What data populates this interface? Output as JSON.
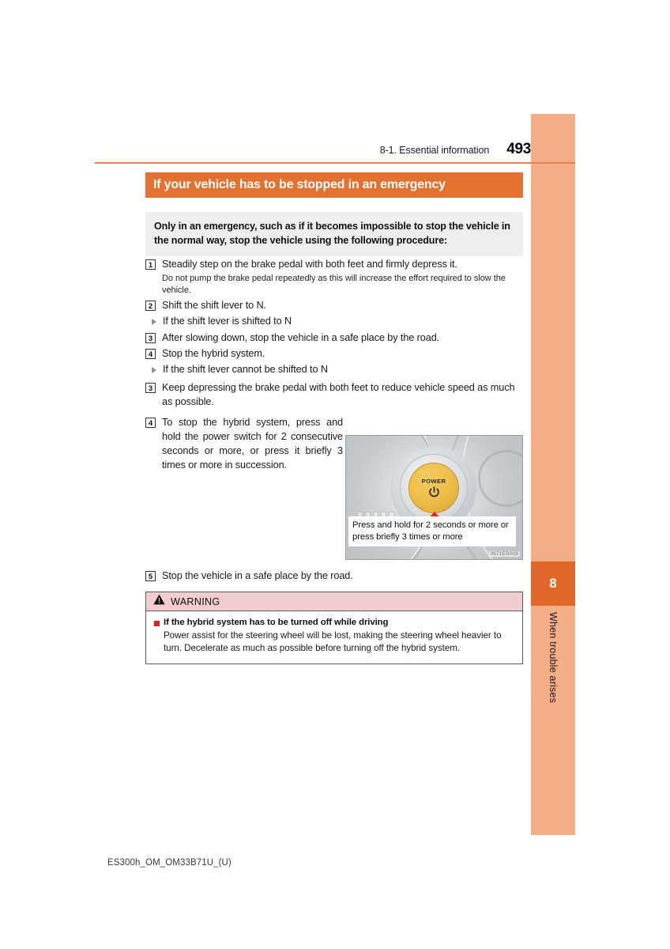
{
  "colors": {
    "accent_orange": "#e3712f",
    "rule_orange": "#e8814f",
    "side_strip": "#f3ae88",
    "chapter_block": "#e1672a",
    "intro_gray": "#eeeeee",
    "warning_pink": "#f2ccce",
    "warning_square_red": "#e02020",
    "power_button_amber": "#eebf4a",
    "arrow_red": "#e12626"
  },
  "running_head": {
    "section": "8-1. Essential information",
    "page_number": "493"
  },
  "section": {
    "title": "If your vehicle has to be stopped in an emergency"
  },
  "intro": {
    "text": "Only in an emergency, such as if it becomes impossible to stop the vehicle in the normal way, stop the vehicle using the following procedure:"
  },
  "steps": [
    {
      "num": "1",
      "text": "Steadily step on the brake pedal with both feet and firmly depress it."
    },
    {
      "note": "Do not pump the brake pedal repeatedly as this will increase the effort required to slow the vehicle."
    },
    {
      "num": "2",
      "text": "Shift the shift lever to N."
    },
    {
      "bullet": "If the shift lever is shifted to N"
    },
    {
      "num": "3",
      "text": "After slowing down, stop the vehicle in a safe place by the road."
    },
    {
      "num": "4",
      "text": "Stop the hybrid system."
    },
    {
      "bullet": "If the shift lever cannot be shifted to N"
    },
    {
      "num": "3",
      "text": "Keep depressing the brake pedal with both feet to reduce vehicle speed as much as possible."
    },
    {
      "num": "4",
      "text": "To stop the hybrid system, press and hold the power switch for 2 consecutive seconds or more, or press it briefly 3 times or more in succession."
    },
    {
      "num": "5",
      "text": "Stop the vehicle in a safe place by the road."
    }
  ],
  "figure": {
    "power_label": "POWER",
    "caption": "Press and hold for 2 seconds or more or press briefly 3 times or more",
    "code": "IN71ES003"
  },
  "warning": {
    "label": "WARNING",
    "subhead": "If the hybrid system has to be turned off while driving",
    "body": "Power assist for the steering wheel will be lost, making the steering wheel heavier to turn. Decelerate as much as possible before turning off the hybrid system."
  },
  "side_tab": {
    "chapter_number": "8",
    "chapter_title": "When trouble arises"
  },
  "footer": {
    "doc_id": "ES300h_OM_OM33B71U_(U)"
  }
}
